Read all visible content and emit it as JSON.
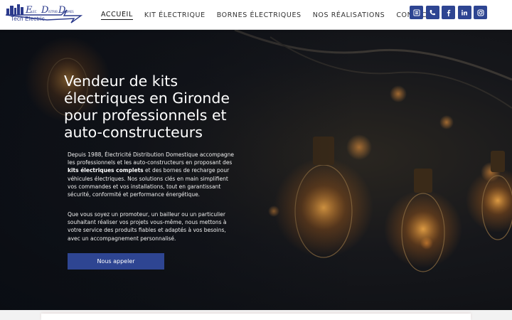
{
  "brand": {
    "logo_text": "Tech Electric",
    "logo_letters": [
      "E",
      "D",
      "D"
    ],
    "logo_small": [
      "LEC",
      "ISTRIB",
      "OMES"
    ]
  },
  "nav": {
    "items": [
      "ACCUEIL",
      "KIT ÉLECTRIQUE",
      "BORNES ÉLECTRIQUES",
      "NOS RÉALISATIONS",
      "CONTACT"
    ],
    "active_index": 0
  },
  "socials": [
    "email-icon",
    "phone-icon",
    "facebook-icon",
    "linkedin-icon",
    "instagram-icon"
  ],
  "hero": {
    "title": "Vendeur de kits électriques en Gironde pour professionnels et auto-constructeurs",
    "p1_before": "Depuis 1988, Électricité Distribution Domestique accompagne les professionnels et les auto-constructeurs en proposant des ",
    "p1_bold": "kits électriques complets",
    "p1_after": " et des bornes de recharge pour véhicules électriques. Nos solutions clés en main simplifient vos commandes et vos installations, tout en garantissant sécurité, conformité et performance énergétique.",
    "p2": "Que vous soyez un promoteur, un bailleur ou un particulier souhaitant réaliser vos projets vous-même, nous mettons à votre service des produits fiables et adaptés à vos besoins, avec un accompagnement personnalisé.",
    "cta": "Nous appeler"
  },
  "colors": {
    "accent": "#2e4592",
    "header_bg": "#ffffff",
    "hero_text": "#ffffff"
  }
}
